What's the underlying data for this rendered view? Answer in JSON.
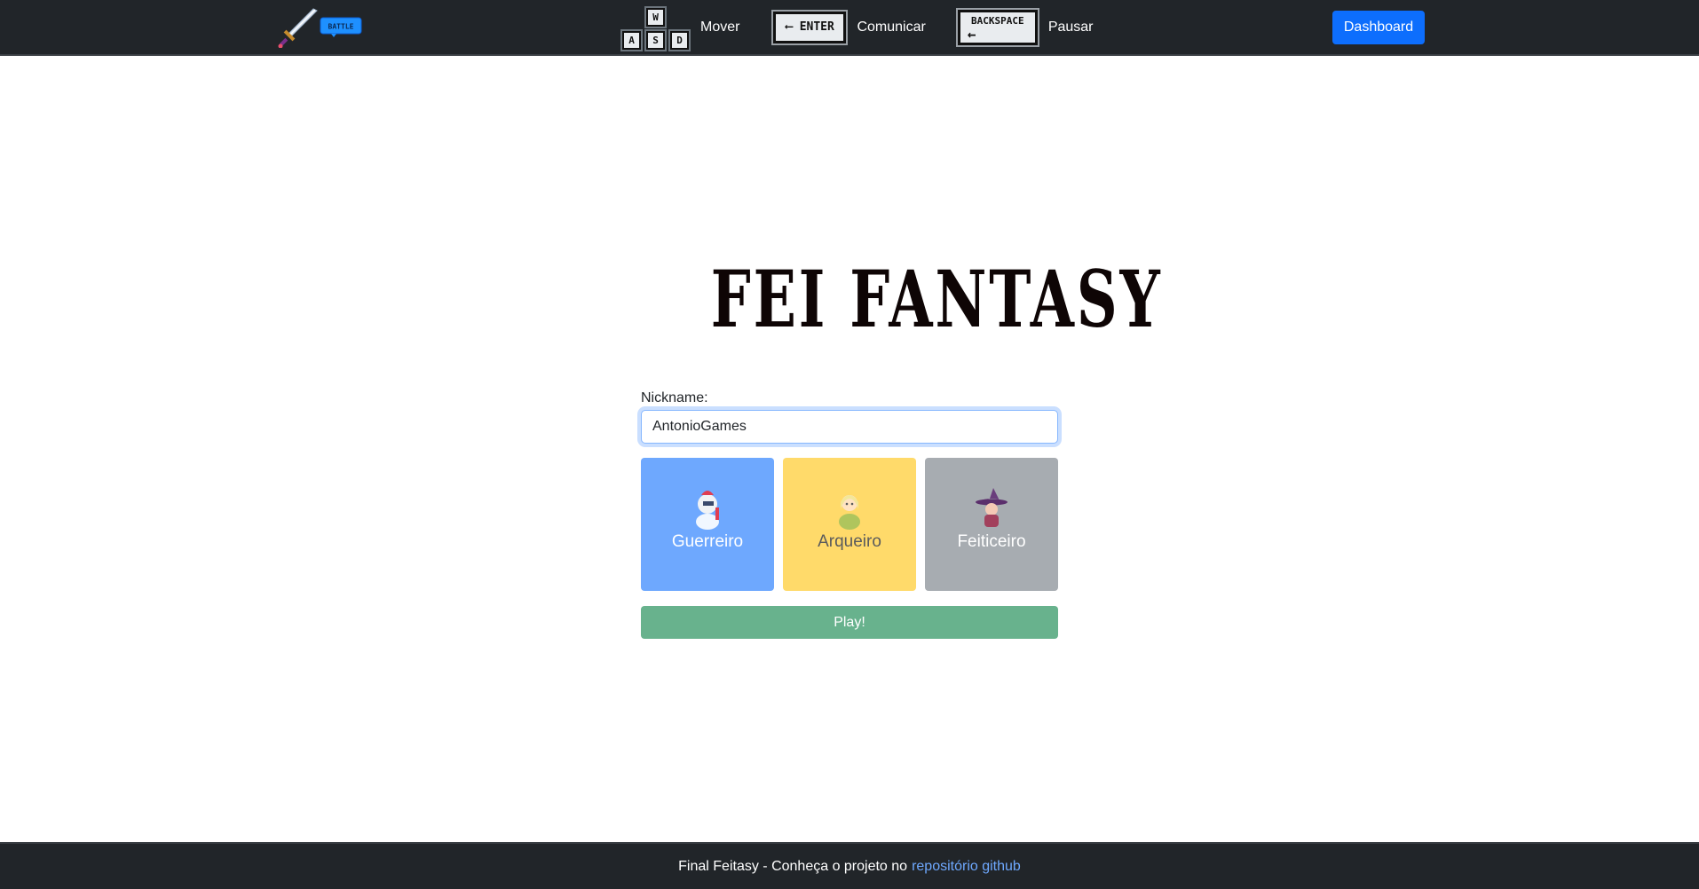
{
  "navbar": {
    "brand": {
      "logo_icon": "sword-battle-logo",
      "badge_text": "BATTLE"
    },
    "controls": [
      {
        "keys": [
          "W",
          "A",
          "S",
          "D"
        ],
        "label": "Mover"
      },
      {
        "key": "ENTER",
        "label": "Comunicar"
      },
      {
        "key": "BACKSPACE",
        "label": "Pausar"
      }
    ],
    "dashboard_label": "Dashboard"
  },
  "main": {
    "title": "FEI FANTASY",
    "nickname_label": "Nickname:",
    "nickname_value": "AntonioGames",
    "classes": [
      {
        "label": "Guerreiro",
        "color": "#6ea8fe",
        "icon": "knight-icon"
      },
      {
        "label": "Arqueiro",
        "color": "#ffda6a",
        "icon": "archer-icon"
      },
      {
        "label": "Feiticeiro",
        "color": "#a7acb1",
        "icon": "wizard-icon"
      }
    ],
    "play_label": "Play!",
    "play_color": "#68b28d"
  },
  "footer": {
    "text": "Final Feitasy - Conheça o projeto no",
    "link_text": "repositório github",
    "link_color": "#6ea8fe"
  },
  "colors": {
    "navbar_bg": "#212529",
    "primary": "#0d6efd"
  }
}
